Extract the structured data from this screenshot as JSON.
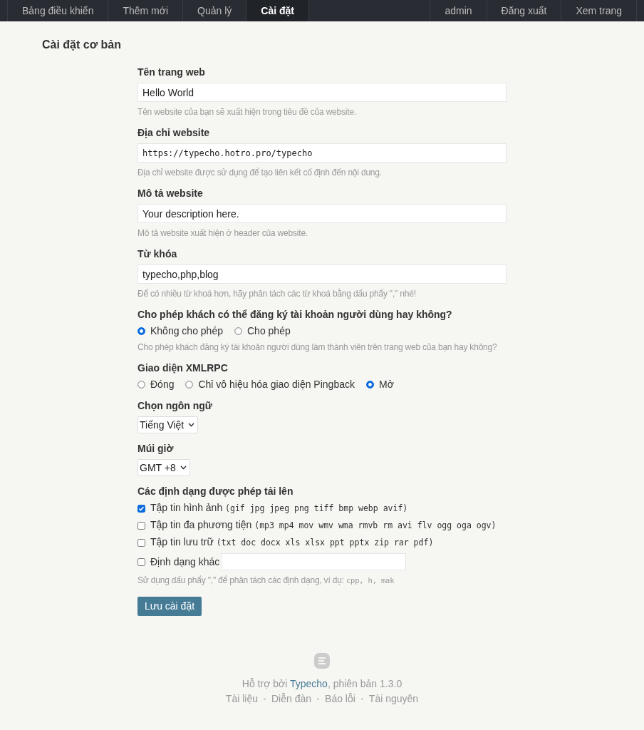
{
  "nav": {
    "left": [
      {
        "label": "Bảng điều khiển",
        "selected": false
      },
      {
        "label": "Thêm mới",
        "selected": false
      },
      {
        "label": "Quản lý",
        "selected": false
      },
      {
        "label": "Cài đặt",
        "selected": true
      }
    ],
    "right": [
      {
        "label": "admin"
      },
      {
        "label": "Đăng xuất"
      },
      {
        "label": "Xem trang"
      }
    ]
  },
  "page_title": "Cài đặt cơ bản",
  "fields": [
    {
      "kind": "text",
      "label": "Tên trang web",
      "value": "Hello World",
      "hint": "Tên website của bạn sẽ xuất hiện trong tiêu đề của website."
    },
    {
      "kind": "url",
      "label": "Địa chỉ website",
      "value": "https://typecho.hotro.pro/typecho",
      "hint": "Địa chỉ website được sử dụng để tạo liên kết cố định đến nội dung."
    },
    {
      "kind": "text",
      "label": "Mô tả website",
      "value": "Your description here.",
      "hint": "Mô tả website xuất hiện ở header của website."
    },
    {
      "kind": "text",
      "label": "Từ khóa",
      "value": "typecho,php,blog",
      "hint": "Để có nhiều từ khoá hơn, hãy phân tách các từ khoá bằng dấu phẩy \",\" nhé!"
    },
    {
      "kind": "radio",
      "label": "Cho phép khách có thể đăng ký tài khoản người dùng hay không?",
      "options": [
        {
          "label": "Không cho phép",
          "selected": true
        },
        {
          "label": "Cho phép",
          "selected": false
        }
      ],
      "hint": "Cho phép khách đăng ký tài khoản người dùng làm thành viên trên trang web của bạn hay không?"
    },
    {
      "kind": "radio",
      "label": "Giao diện XMLRPC",
      "options": [
        {
          "label": "Đóng",
          "selected": false
        },
        {
          "label": "Chỉ vô hiệu hóa giao diện Pingback",
          "selected": false
        },
        {
          "label": "Mở",
          "selected": true
        }
      ]
    },
    {
      "kind": "select",
      "label": "Chọn ngôn ngữ",
      "value": "Tiếng Việt"
    },
    {
      "kind": "select",
      "label": "Múi giờ",
      "value": "GMT +8"
    },
    {
      "kind": "checkboxes",
      "label": "Các định dạng được phép tải lên",
      "options": [
        {
          "label": "Tập tin hình ảnh",
          "formats": "(gif jpg jpeg png tiff bmp webp avif)",
          "checked": true
        },
        {
          "label": "Tập tin đa phương tiện",
          "formats": "(mp3 mp4 mov wmv wma rmvb rm avi flv ogg oga ogv)",
          "checked": false
        },
        {
          "label": "Tập tin lưu trữ",
          "formats": "(txt doc docx xls xlsx ppt pptx zip rar pdf)",
          "checked": false
        },
        {
          "label": "Định dạng khác",
          "has_input": true,
          "checked": false
        }
      ],
      "hint": "Sử dụng dấu phẩy \",\" để phân tách các định dạng, ví dụ:",
      "hint_code": "cpp, h, mak"
    }
  ],
  "submit": "Lưu cài đặt",
  "footer": {
    "prefix": "Hỗ trợ bởi",
    "link": "Typecho",
    "suffix": ", phiên bản 1.3.0",
    "links": [
      "Tài liệu",
      "Diễn đàn",
      "Báo lỗi",
      "Tài nguyên"
    ]
  }
}
